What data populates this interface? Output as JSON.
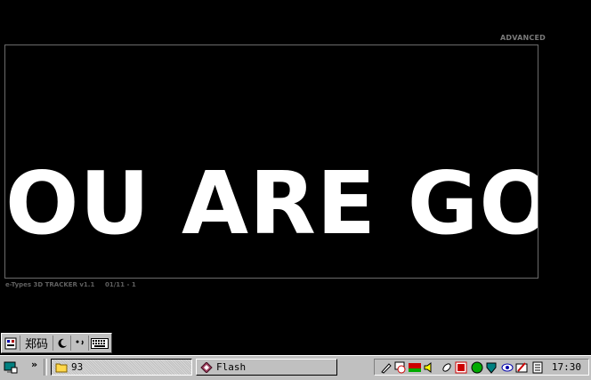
{
  "header": {
    "advanced_label": "ADVANCED"
  },
  "viewport": {
    "big_text": "OU ARE GO"
  },
  "footer": {
    "tracker_label": "e-Types 3D TRACKER v1.1",
    "date_label": "01/11 - 1"
  },
  "ime": {
    "input_method_label": "郑码",
    "icons": [
      "ime-logo-icon",
      "moon-icon",
      "punctuation-icon",
      "soft-keyboard-icon"
    ]
  },
  "taskbar": {
    "quicklaunch_chevron": "»",
    "tasks": [
      {
        "label": "93",
        "icon": "folder-icon",
        "state": "pressed"
      },
      {
        "label": "Flash",
        "icon": "flash-icon",
        "state": "raised"
      }
    ],
    "tray_icons": [
      "pen-icon",
      "clock-app-icon",
      "tele-icon",
      "speaker-icon",
      "network-icon",
      "rs-icon",
      "globe-icon",
      "shield-icon",
      "eye-icon",
      "paint-icon",
      "notes-icon"
    ],
    "clock": "17:30"
  },
  "colors": {
    "background": "#000000",
    "taskbar": "#c0c0c0",
    "text_white": "#ffffff"
  }
}
